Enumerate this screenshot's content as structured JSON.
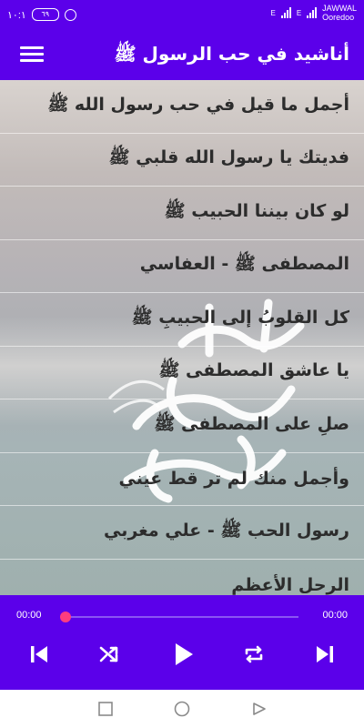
{
  "status_bar": {
    "time": "١٠:١",
    "battery": "٦٩",
    "carrier_line1": "JAWWAL",
    "carrier_line2": "Ooredoo",
    "network_type": "E"
  },
  "app_bar": {
    "title": "أناشيد في حب الرسول ﷺ",
    "menu_icon": "hamburger-menu-icon"
  },
  "songs": [
    {
      "title": "أجمل ما قيل في حب رسول الله ﷺ"
    },
    {
      "title": "فديتك يا رسول الله قلبي ﷺ"
    },
    {
      "title": "لو كان بيننا الحبيب ﷺ"
    },
    {
      "title": "المصطفى ﷺ - العفاسي"
    },
    {
      "title": "كل القلوبُ إلى الحبيبِ ﷺ"
    },
    {
      "title": "يا عاشق المصطفى ﷺ"
    },
    {
      "title": "صلِ على المصطفى ﷺ"
    },
    {
      "title": "وأجمل منك لم تر قط عيني"
    },
    {
      "title": "رسول الحب ﷺ - علي مغربي"
    },
    {
      "title": "الرحل الأعظم"
    }
  ],
  "player": {
    "current_time": "00:00",
    "total_time": "00:00",
    "progress": 0,
    "controls": [
      "skip-previous-icon",
      "shuffle-icon",
      "play-icon",
      "repeat-icon",
      "skip-next-icon"
    ]
  },
  "nav_bar": {
    "buttons": [
      "recents-square-icon",
      "home-circle-icon",
      "back-triangle-icon"
    ]
  },
  "colors": {
    "primary": "#5b00ea",
    "seek_thumb": "#ff3d7f",
    "row_text": "#2c2c2c"
  }
}
